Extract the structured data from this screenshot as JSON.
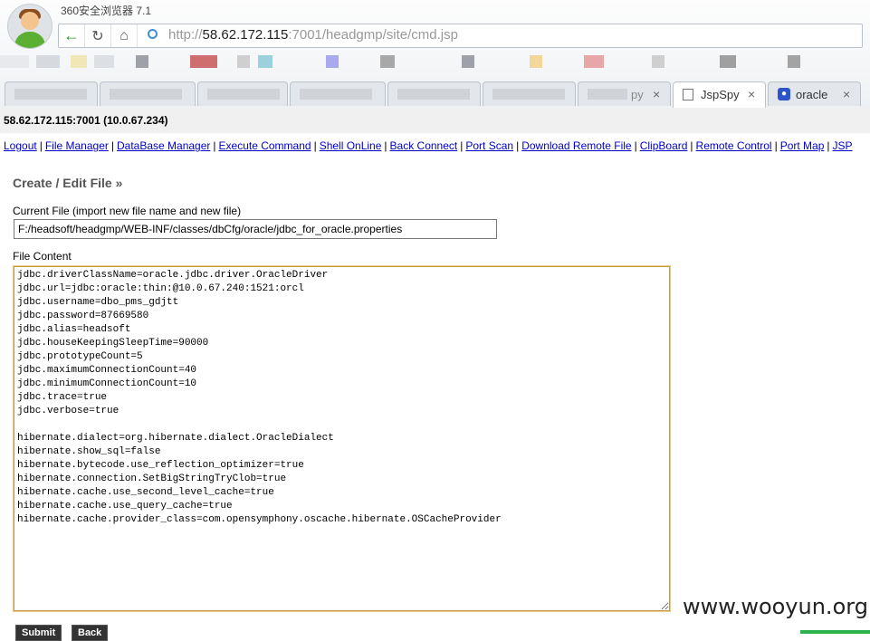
{
  "browser": {
    "title": "360安全浏览器 7.1",
    "url_scheme": "http://",
    "url_host": "58.62.172.115",
    "url_rest": ":7001/headgmp/site/cmd.jsp",
    "tabs": [
      {
        "label": "py",
        "close": "×"
      },
      {
        "label": "JspSpy",
        "close": "×"
      },
      {
        "label": "oracle",
        "close": "×"
      }
    ]
  },
  "page": {
    "host_info": "58.62.172.115:7001 (10.0.67.234)",
    "menu": [
      "Logout",
      "File Manager",
      "DataBase Manager",
      "Execute Command",
      "Shell OnLine",
      "Back Connect",
      "Port Scan",
      "Download Remote File",
      "ClipBoard",
      "Remote Control",
      "Port Map",
      "JSP"
    ],
    "menu_separator": "|",
    "section_title": "Create / Edit File »",
    "current_file_label": "Current File (import new file name and new file)",
    "current_file_value": "F:/headsoft/headgmp/WEB-INF/classes/dbCfg/oracle/jdbc_for_oracle.properties",
    "file_content_label": "File Content",
    "file_content": "jdbc.driverClassName=oracle.jdbc.driver.OracleDriver\njdbc.url=jdbc:oracle:thin:@10.0.67.240:1521:orcl\njdbc.username=dbo_pms_gdjtt\njdbc.password=87669580\njdbc.alias=headsoft\njdbc.houseKeepingSleepTime=90000\njdbc.prototypeCount=5\njdbc.maximumConnectionCount=40\njdbc.minimumConnectionCount=10\njdbc.trace=true\njdbc.verbose=true\n\nhibernate.dialect=org.hibernate.dialect.OracleDialect\nhibernate.show_sql=false\nhibernate.bytecode.use_reflection_optimizer=true\nhibernate.connection.SetBigStringTryClob=true\nhibernate.cache.use_second_level_cache=true\nhibernate.cache.use_query_cache=true\nhibernate.cache.provider_class=com.opensymphony.oscache.hibernate.OSCacheProvider",
    "submit_label": "Submit",
    "back_label": "Back"
  },
  "watermark": "www.wooyun.org",
  "colors": {
    "link": "#0000cc",
    "textarea_border": "#c89b3c",
    "host_bar": "#f0f0f0",
    "back_arrow": "#2a9a2a"
  },
  "icons": [
    "user-avatar-icon",
    "back-arrow-icon",
    "reload-icon",
    "home-icon",
    "site-icon",
    "document-icon",
    "baidu-paw-icon",
    "close-icon"
  ]
}
